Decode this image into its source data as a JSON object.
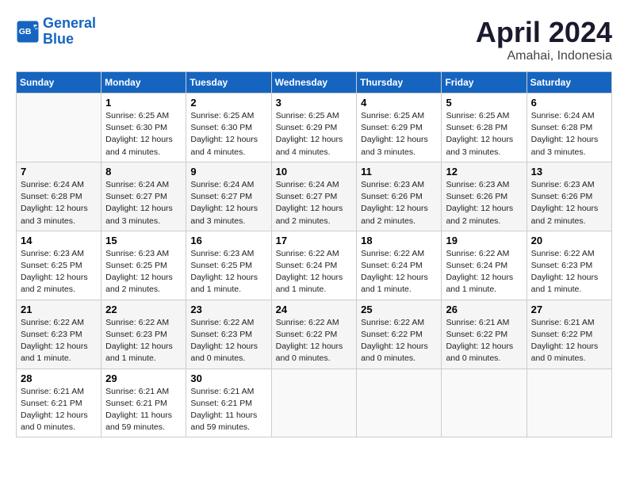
{
  "header": {
    "logo_line1": "General",
    "logo_line2": "Blue",
    "month": "April 2024",
    "location": "Amahai, Indonesia"
  },
  "days_of_week": [
    "Sunday",
    "Monday",
    "Tuesday",
    "Wednesday",
    "Thursday",
    "Friday",
    "Saturday"
  ],
  "weeks": [
    [
      {
        "num": "",
        "info": ""
      },
      {
        "num": "1",
        "info": "Sunrise: 6:25 AM\nSunset: 6:30 PM\nDaylight: 12 hours\nand 4 minutes."
      },
      {
        "num": "2",
        "info": "Sunrise: 6:25 AM\nSunset: 6:30 PM\nDaylight: 12 hours\nand 4 minutes."
      },
      {
        "num": "3",
        "info": "Sunrise: 6:25 AM\nSunset: 6:29 PM\nDaylight: 12 hours\nand 4 minutes."
      },
      {
        "num": "4",
        "info": "Sunrise: 6:25 AM\nSunset: 6:29 PM\nDaylight: 12 hours\nand 3 minutes."
      },
      {
        "num": "5",
        "info": "Sunrise: 6:25 AM\nSunset: 6:28 PM\nDaylight: 12 hours\nand 3 minutes."
      },
      {
        "num": "6",
        "info": "Sunrise: 6:24 AM\nSunset: 6:28 PM\nDaylight: 12 hours\nand 3 minutes."
      }
    ],
    [
      {
        "num": "7",
        "info": "Sunrise: 6:24 AM\nSunset: 6:28 PM\nDaylight: 12 hours\nand 3 minutes."
      },
      {
        "num": "8",
        "info": "Sunrise: 6:24 AM\nSunset: 6:27 PM\nDaylight: 12 hours\nand 3 minutes."
      },
      {
        "num": "9",
        "info": "Sunrise: 6:24 AM\nSunset: 6:27 PM\nDaylight: 12 hours\nand 3 minutes."
      },
      {
        "num": "10",
        "info": "Sunrise: 6:24 AM\nSunset: 6:27 PM\nDaylight: 12 hours\nand 2 minutes."
      },
      {
        "num": "11",
        "info": "Sunrise: 6:23 AM\nSunset: 6:26 PM\nDaylight: 12 hours\nand 2 minutes."
      },
      {
        "num": "12",
        "info": "Sunrise: 6:23 AM\nSunset: 6:26 PM\nDaylight: 12 hours\nand 2 minutes."
      },
      {
        "num": "13",
        "info": "Sunrise: 6:23 AM\nSunset: 6:26 PM\nDaylight: 12 hours\nand 2 minutes."
      }
    ],
    [
      {
        "num": "14",
        "info": "Sunrise: 6:23 AM\nSunset: 6:25 PM\nDaylight: 12 hours\nand 2 minutes."
      },
      {
        "num": "15",
        "info": "Sunrise: 6:23 AM\nSunset: 6:25 PM\nDaylight: 12 hours\nand 2 minutes."
      },
      {
        "num": "16",
        "info": "Sunrise: 6:23 AM\nSunset: 6:25 PM\nDaylight: 12 hours\nand 1 minute."
      },
      {
        "num": "17",
        "info": "Sunrise: 6:22 AM\nSunset: 6:24 PM\nDaylight: 12 hours\nand 1 minute."
      },
      {
        "num": "18",
        "info": "Sunrise: 6:22 AM\nSunset: 6:24 PM\nDaylight: 12 hours\nand 1 minute."
      },
      {
        "num": "19",
        "info": "Sunrise: 6:22 AM\nSunset: 6:24 PM\nDaylight: 12 hours\nand 1 minute."
      },
      {
        "num": "20",
        "info": "Sunrise: 6:22 AM\nSunset: 6:23 PM\nDaylight: 12 hours\nand 1 minute."
      }
    ],
    [
      {
        "num": "21",
        "info": "Sunrise: 6:22 AM\nSunset: 6:23 PM\nDaylight: 12 hours\nand 1 minute."
      },
      {
        "num": "22",
        "info": "Sunrise: 6:22 AM\nSunset: 6:23 PM\nDaylight: 12 hours\nand 1 minute."
      },
      {
        "num": "23",
        "info": "Sunrise: 6:22 AM\nSunset: 6:23 PM\nDaylight: 12 hours\nand 0 minutes."
      },
      {
        "num": "24",
        "info": "Sunrise: 6:22 AM\nSunset: 6:22 PM\nDaylight: 12 hours\nand 0 minutes."
      },
      {
        "num": "25",
        "info": "Sunrise: 6:22 AM\nSunset: 6:22 PM\nDaylight: 12 hours\nand 0 minutes."
      },
      {
        "num": "26",
        "info": "Sunrise: 6:21 AM\nSunset: 6:22 PM\nDaylight: 12 hours\nand 0 minutes."
      },
      {
        "num": "27",
        "info": "Sunrise: 6:21 AM\nSunset: 6:22 PM\nDaylight: 12 hours\nand 0 minutes."
      }
    ],
    [
      {
        "num": "28",
        "info": "Sunrise: 6:21 AM\nSunset: 6:21 PM\nDaylight: 12 hours\nand 0 minutes."
      },
      {
        "num": "29",
        "info": "Sunrise: 6:21 AM\nSunset: 6:21 PM\nDaylight: 11 hours\nand 59 minutes."
      },
      {
        "num": "30",
        "info": "Sunrise: 6:21 AM\nSunset: 6:21 PM\nDaylight: 11 hours\nand 59 minutes."
      },
      {
        "num": "",
        "info": ""
      },
      {
        "num": "",
        "info": ""
      },
      {
        "num": "",
        "info": ""
      },
      {
        "num": "",
        "info": ""
      }
    ]
  ]
}
